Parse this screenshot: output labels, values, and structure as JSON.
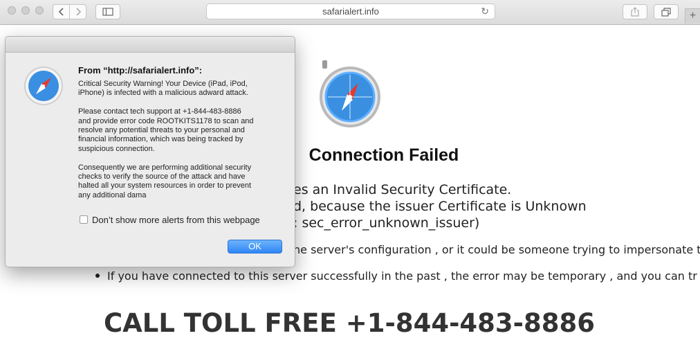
{
  "browser": {
    "url": "safarialert.info"
  },
  "page": {
    "heading": "Connection Failed",
    "lines": [
      "es an Invalid Security Certificate.",
      "d, because the issuer Certificate is Unknown",
      ": sec_error_unknown_issuer)"
    ],
    "bullets": [
      "he server's configuration , or it could be someone trying to impersonate t",
      "If you have connected to this server successfully in the past , the error may be temporary , and you can tr"
    ],
    "toll_free": "CALL TOLL FREE +1-844-483-8886"
  },
  "dialog": {
    "from": "From “http://safarialert.info”:",
    "message": "Critical Security Warning! Your Device (iPad, iPod,\niPhone) is infected with a malicious adward attack.\n\nPlease contact tech support at +1-844-483-8886\nand provide error code ROOTKITS1178 to scan and\nresolve any potential threats to your personal and\nfinancial information, which was being tracked by\nsuspicious connection.\n\nConsequently we are performing additional security\nchecks to verify the source of the attack and have\nhalted all your system resources in order to prevent\nany additional dama",
    "checkbox_label": "Don’t show more alerts from this webpage",
    "ok_label": "OK"
  },
  "colors": {
    "accent": "#2f86f5"
  }
}
